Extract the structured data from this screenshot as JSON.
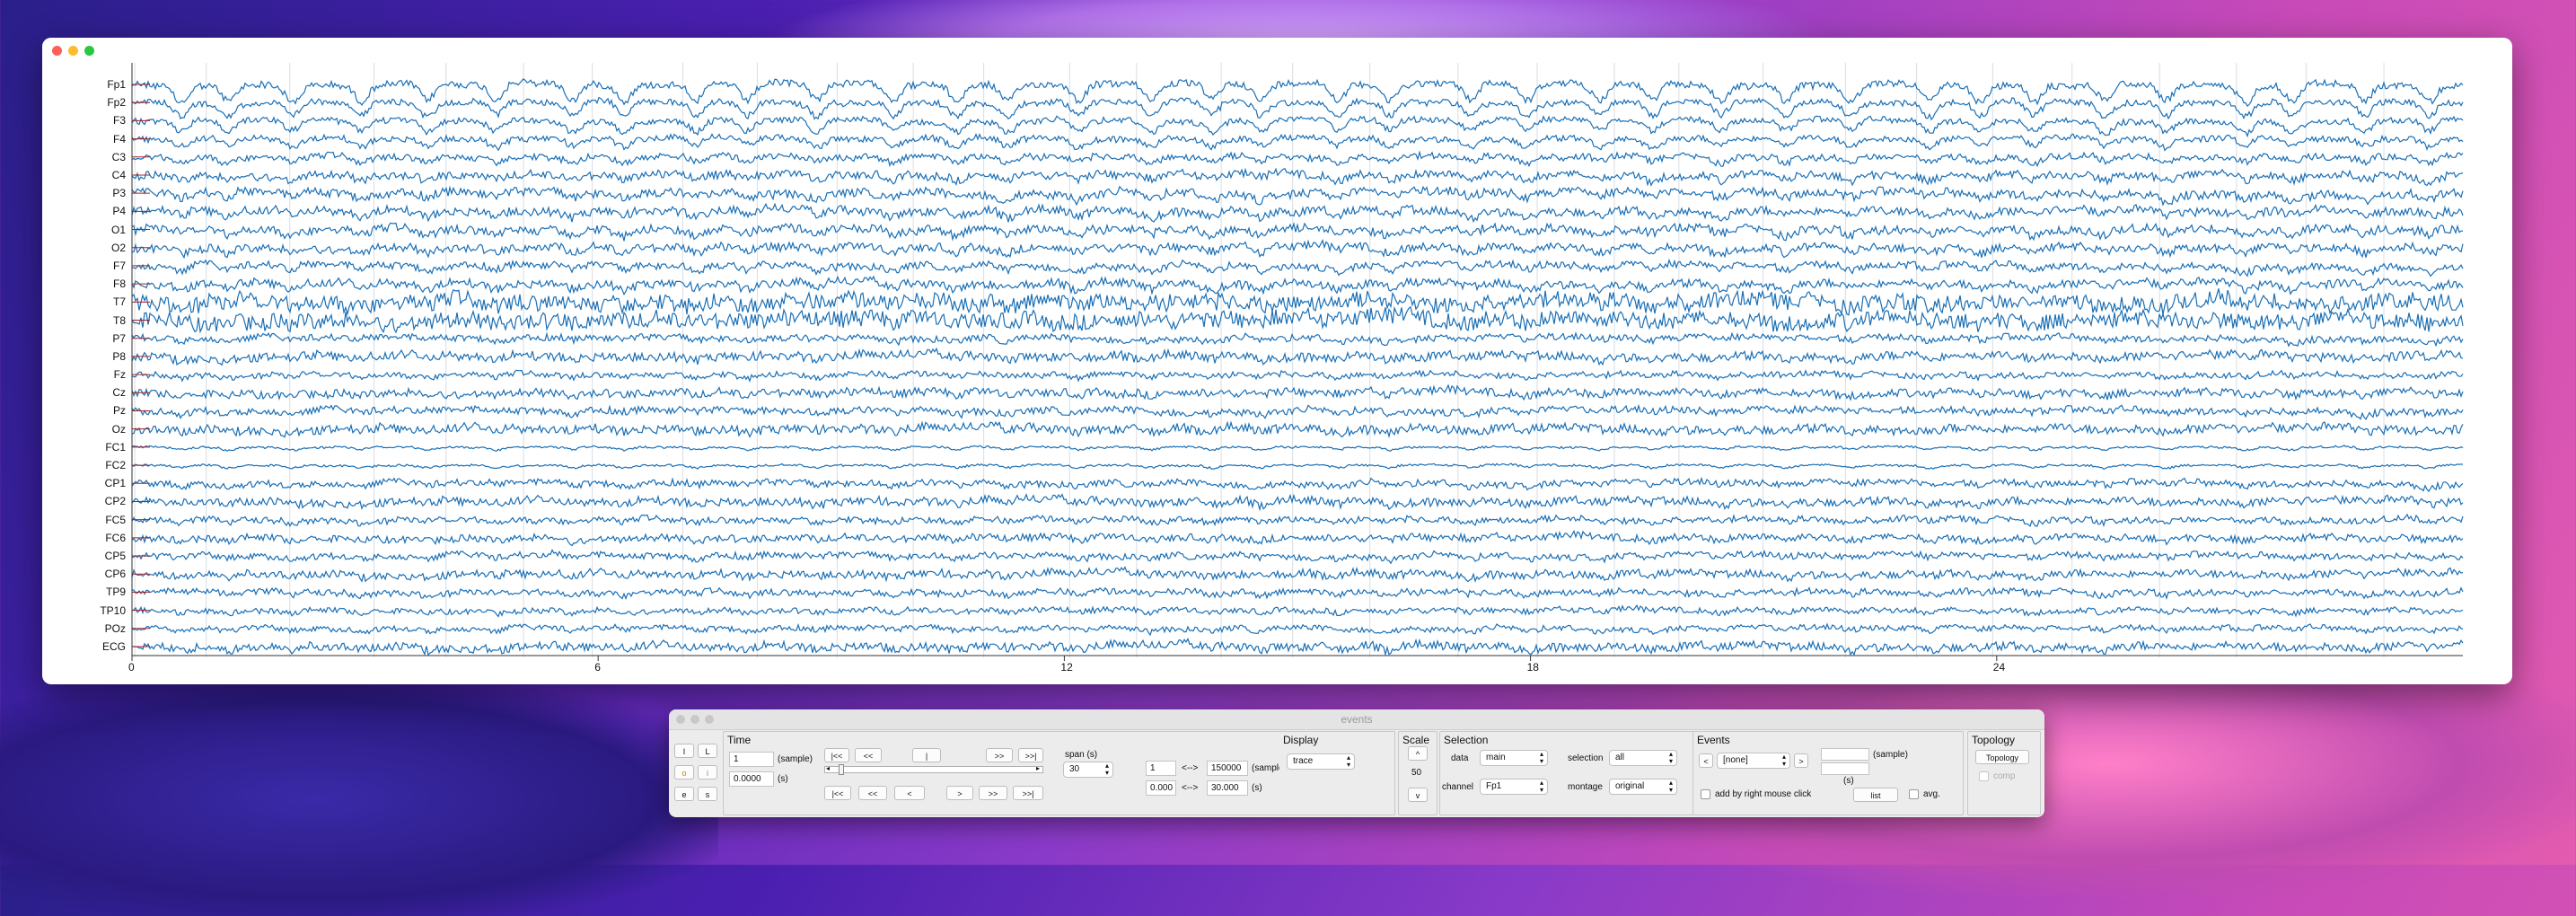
{
  "main_window": {
    "channels": [
      "Fp1",
      "Fp2",
      "F3",
      "F4",
      "C3",
      "C4",
      "P3",
      "P4",
      "O1",
      "O2",
      "F7",
      "F8",
      "T7",
      "T8",
      "P7",
      "P8",
      "Fz",
      "Cz",
      "Pz",
      "Oz",
      "FC1",
      "FC2",
      "CP1",
      "CP2",
      "FC5",
      "FC6",
      "CP5",
      "CP6",
      "TP9",
      "TP10",
      "POz",
      "ECG"
    ],
    "x_ticks": [
      "0",
      "6",
      "12",
      "18",
      "24"
    ],
    "trace_color": "#1a6fb5"
  },
  "events_window": {
    "title": "events",
    "side_buttons": [
      "I",
      "L",
      "o",
      "i",
      "e",
      "s"
    ],
    "time": {
      "title": "Time",
      "sample_value": "1",
      "sample_unit": "(sample)",
      "seconds_value": "0.0000",
      "seconds_unit": "(s)",
      "nav_top": [
        "|<<",
        "<<",
        "|",
        ">>",
        ">>|"
      ],
      "nav_bottom": [
        "|<<",
        "<<",
        "<",
        ">",
        ">>",
        ">>|"
      ],
      "span_label": "span (s)",
      "span_value": "30",
      "range_start_sample": "1",
      "range_end_sample": "150000",
      "range_sample_unit": "(sample)",
      "range_start_s": "0.000",
      "range_end_s": "30.000",
      "range_s_unit": "(s)",
      "range_arrow": "<-->"
    },
    "display": {
      "title": "Display",
      "mode": "trace"
    },
    "scale": {
      "title": "Scale",
      "up": "^",
      "value": "50",
      "down": "v"
    },
    "selection": {
      "title": "Selection",
      "data_label": "data",
      "data_value": "main",
      "selection_label": "selection",
      "selection_value": "all",
      "channel_label": "channel",
      "channel_value": "Fp1",
      "montage_label": "montage",
      "montage_value": "original"
    },
    "events": {
      "title": "Events",
      "prev": "<",
      "event_value": "[none]",
      "next": ">",
      "sample_unit": "(sample)",
      "s_unit": "(s)",
      "add_label": "add by right mouse click",
      "list_button": "list",
      "avg_label": "avg."
    },
    "topology": {
      "title": "Topology",
      "button": "Topology",
      "comp_label": "comp"
    }
  }
}
